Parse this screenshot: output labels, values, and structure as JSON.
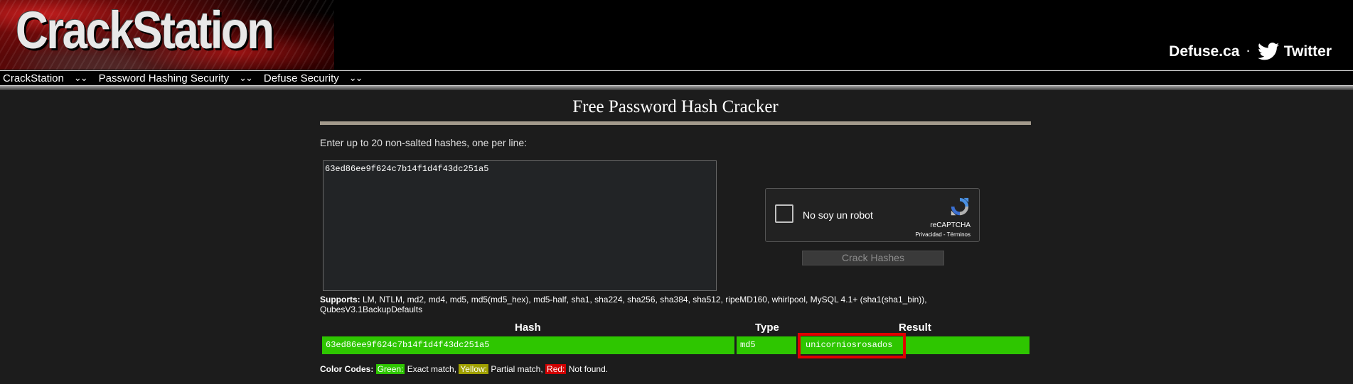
{
  "header": {
    "logo_text": "CrackStation",
    "defuse_link": "Defuse.ca",
    "separator": "·",
    "twitter_link": "Twitter"
  },
  "nav": {
    "items": [
      {
        "label": "CrackStation"
      },
      {
        "label": "Password Hashing Security"
      },
      {
        "label": "Defuse Security"
      }
    ]
  },
  "main": {
    "title": "Free Password Hash Cracker",
    "instructions": "Enter up to 20 non-salted hashes, one per line:",
    "hash_input_value": "63ed86ee9f624c7b14f1d4f43dc251a5",
    "captcha": {
      "label": "No soy un robot",
      "brand": "reCAPTCHA",
      "terms": "Privacidad - Términos"
    },
    "crack_button": "Crack Hashes",
    "supports_label": "Supports:",
    "supports_text": " LM, NTLM, md2, md4, md5, md5(md5_hex), md5-half, sha1, sha224, sha256, sha384, sha512, ripeMD160, whirlpool, MySQL 4.1+ (sha1(sha1_bin)), QubesV3.1BackupDefaults"
  },
  "results": {
    "headers": {
      "hash": "Hash",
      "type": "Type",
      "result": "Result"
    },
    "rows": [
      {
        "hash": "63ed86ee9f624c7b14f1d4f43dc251a5",
        "type": "md5",
        "result": "unicorniosrosados",
        "status_color": "#2ec600"
      }
    ]
  },
  "color_codes": {
    "label": "Color Codes:",
    "green": "Green:",
    "green_text": " Exact match, ",
    "yellow": "Yellow:",
    "yellow_text": " Partial match, ",
    "red": "Red:",
    "red_text": " Not found."
  },
  "colors": {
    "match_green": "#2ec600",
    "highlight_red": "#e00000",
    "title_rule": "#a39a8c"
  }
}
